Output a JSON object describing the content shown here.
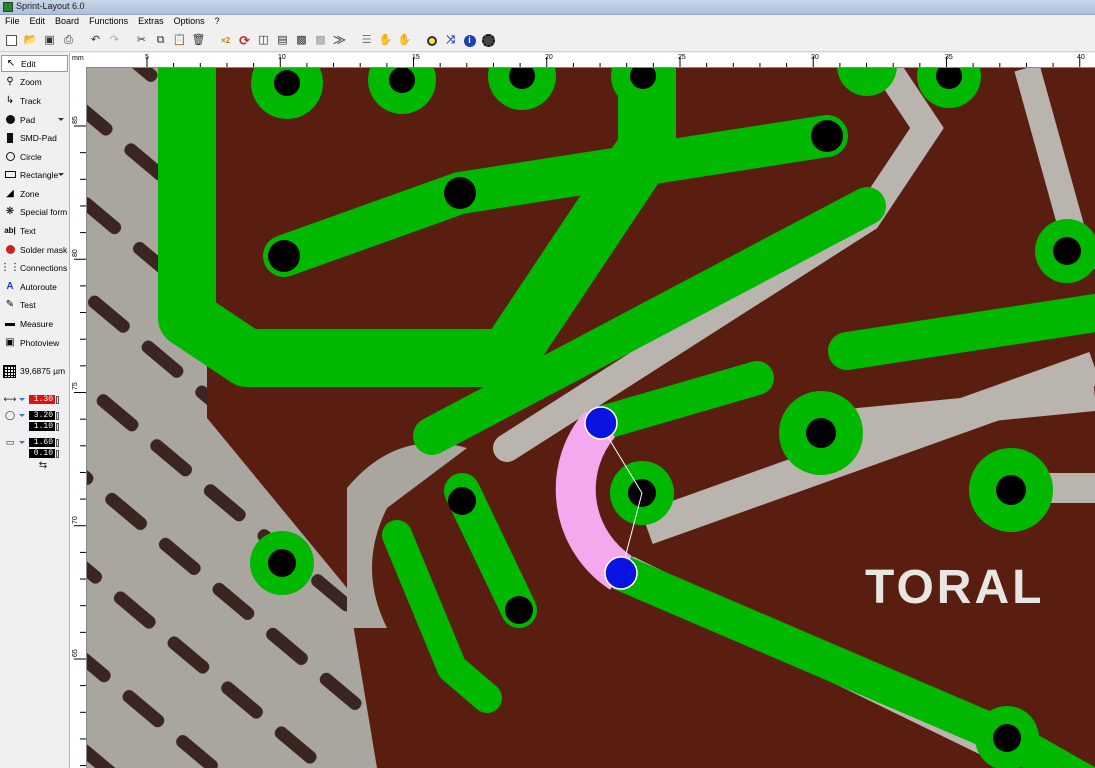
{
  "window": {
    "title": "Sprint-Layout 6.0"
  },
  "menu": [
    "File",
    "Edit",
    "Board",
    "Functions",
    "Extras",
    "Options",
    "?"
  ],
  "toolbar": {
    "buttons": [
      "new-icon",
      "open-icon",
      "save-icon",
      "print-icon",
      "undo-icon",
      "redo-icon",
      "cut-icon",
      "copy-icon",
      "paste-icon",
      "delete-icon",
      "x2-icon",
      "rotate-icon",
      "mirror-h-icon",
      "mirror-v-icon",
      "group-icon",
      "ungroup-icon",
      "align-icon",
      "lock-icon",
      "unlock-icon",
      "zoom-icon",
      "drc-icon",
      "info-icon",
      "settings-icon"
    ]
  },
  "tools": [
    {
      "name": "tool-edit",
      "label": "Edit",
      "icon": "arrow-icon",
      "active": true
    },
    {
      "name": "tool-zoom",
      "label": "Zoom",
      "icon": "magnifier-icon"
    },
    {
      "name": "tool-track",
      "label": "Track",
      "icon": "track-icon"
    },
    {
      "name": "tool-pad",
      "label": "Pad",
      "icon": "pad-icon",
      "dropdown": true
    },
    {
      "name": "tool-smd-pad",
      "label": "SMD-Pad",
      "icon": "smd-icon"
    },
    {
      "name": "tool-circle",
      "label": "Circle",
      "icon": "circle-icon"
    },
    {
      "name": "tool-rectangle",
      "label": "Rectangle",
      "icon": "rectangle-icon",
      "dropdown": true
    },
    {
      "name": "tool-zone",
      "label": "Zone",
      "icon": "zone-icon"
    },
    {
      "name": "tool-special-form",
      "label": "Special form",
      "icon": "special-form-icon"
    },
    {
      "name": "tool-text",
      "label": "Text",
      "icon": "text-icon"
    },
    {
      "name": "tool-solder-mask",
      "label": "Solder mask",
      "icon": "solder-mask-icon"
    },
    {
      "name": "tool-connections",
      "label": "Connections",
      "icon": "connections-icon"
    },
    {
      "name": "tool-autoroute",
      "label": "Autoroute",
      "icon": "autoroute-icon"
    },
    {
      "name": "tool-test",
      "label": "Test",
      "icon": "test-icon"
    },
    {
      "name": "tool-measure",
      "label": "Measure",
      "icon": "measure-icon"
    },
    {
      "name": "tool-photoview",
      "label": "Photoview",
      "icon": "photoview-icon"
    }
  ],
  "grid": {
    "value": "39,6875 µm"
  },
  "params": {
    "track_width": "1.30",
    "pad_outer": "3.20",
    "pad_inner": "1.10",
    "smd_w": "1.60",
    "smd_h": "0.10"
  },
  "ruler": {
    "unit": "mm",
    "top_ticks": [
      "5",
      "10",
      "15",
      "20",
      "25",
      "30",
      "35",
      "40"
    ],
    "left_ticks": [
      "85",
      "80",
      "75",
      "70",
      "65"
    ]
  },
  "board": {
    "silkscreen_text": "TORAL"
  },
  "colors": {
    "track": "#00b800",
    "selected": "#f4a8ee",
    "handle": "#0a14e0",
    "copper_bg": "#5a1e10"
  }
}
